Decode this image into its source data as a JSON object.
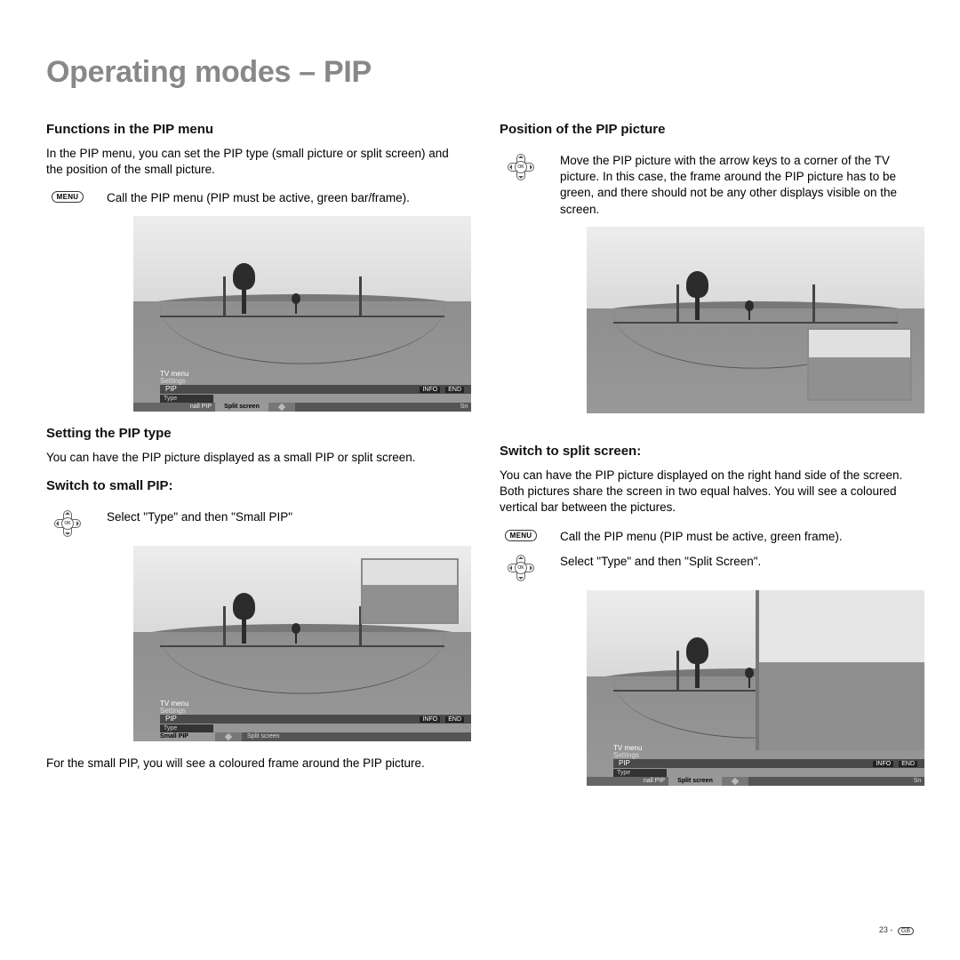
{
  "title": "Operating modes – PIP",
  "left": {
    "sec1_heading": "Functions in the PIP menu",
    "sec1_body": "In the PIP menu, you can set the PIP type (small picture or split screen) and the position of the small picture.",
    "menu_instr": "Call the PIP menu (PIP must be active, green bar/frame).",
    "sec2_heading": "Setting the PIP type",
    "sec2_body": "You can have the PIP picture displayed as a small PIP or split screen.",
    "sec3_heading": "Switch to small PIP:",
    "ok_instr": "Select \"Type\" and then \"Small PIP\"",
    "caption": "For the small PIP, you will see a coloured frame around the PIP picture."
  },
  "right": {
    "sec1_heading": "Position of the PIP picture",
    "ok_instr": "Move the PIP picture with the arrow keys to a corner of the TV picture. In this case, the frame around the PIP picture has to be green, and there should not be any other displays visible on the screen.",
    "sec2_heading": "Switch to split screen:",
    "sec2_body": "You can have the PIP picture displayed on the right hand side of the screen. Both pictures share the screen in two equal halves. You will see a coloured vertical bar between the pictures.",
    "menu_instr": "Call the PIP menu (PIP must be active, green frame).",
    "ok_instr2": "Select \"Type\" and then \"Split Screen\"."
  },
  "osd": {
    "crumb1": "TV menu",
    "crumb2": "Settings",
    "pip": "PIP",
    "type": "Type",
    "small_pip": "Small PIP",
    "split_screen": "Split screen",
    "nall_pip": "nall PIP",
    "sn": "Sn",
    "info": "INFO",
    "end": "END"
  },
  "buttons": {
    "menu": "MENU",
    "ok": "OK"
  },
  "footer": {
    "page": "23 - ",
    "gb": "GB"
  }
}
